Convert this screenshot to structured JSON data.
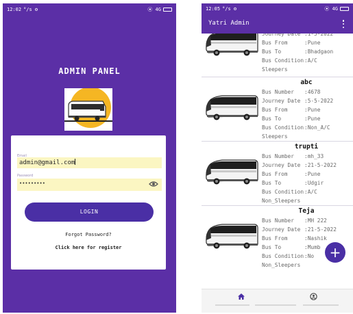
{
  "left": {
    "status": {
      "time": "12:02",
      "icons": "°/s ⚙",
      "right": "⦿ 4G"
    },
    "title": "ADMIN PANEL",
    "email_label": "Email",
    "email_value": "admin@gmail.com",
    "password_label": "Password",
    "password_value": "•••••••••",
    "login_label": "LOGIN",
    "forgot_label": "Forgot Password?",
    "register_label": "Click here for register"
  },
  "right": {
    "status": {
      "time": "12:05",
      "icons": "°/s ⚙",
      "right": "⦿ 4G"
    },
    "app_title": "Yatri Admin",
    "cards": [
      {
        "name": "",
        "fields": [
          {
            "k": "Journey Date",
            "v": ":1-5-2022"
          },
          {
            "k": "Bus From",
            "v": ":Pune"
          },
          {
            "k": "Bus To",
            "v": ":Bhadgaon"
          },
          {
            "k": "Bus Condition",
            "v": ":A/C"
          }
        ],
        "tail": "Sleepers"
      },
      {
        "name": "abc",
        "fields": [
          {
            "k": "Bus Number",
            "v": ":4678"
          },
          {
            "k": "Journey Date",
            "v": ":5-5-2022"
          },
          {
            "k": "Bus From",
            "v": ":Pune"
          },
          {
            "k": "Bus To",
            "v": ":Pune"
          },
          {
            "k": "Bus Condition",
            "v": ":Non_A/C"
          }
        ],
        "tail": "Sleepers"
      },
      {
        "name": "trupti",
        "fields": [
          {
            "k": "Bus Number",
            "v": ":mh_33"
          },
          {
            "k": "Journey Date",
            "v": ":21-5-2022"
          },
          {
            "k": "Bus From",
            "v": ":Pune"
          },
          {
            "k": "Bus To",
            "v": ":Udgir"
          },
          {
            "k": "Bus Condition",
            "v": ":A/C"
          }
        ],
        "tail": "Non_Sleepers"
      },
      {
        "name": "Teja",
        "fields": [
          {
            "k": "Bus Number",
            "v": ":MH 222"
          },
          {
            "k": "Journey Date",
            "v": ":21-5-2022"
          },
          {
            "k": "Bus From",
            "v": ":Nashik"
          },
          {
            "k": "Bus To",
            "v": ":Mumb"
          },
          {
            "k": "Bus Condition",
            "v": ":No"
          }
        ],
        "tail": "Non_Sleepers"
      }
    ],
    "fab_label": "+",
    "nav": {
      "home_icon": "home-icon",
      "profile_icon": "account-circle-icon"
    }
  },
  "colors": {
    "primary": "#5b2fa6",
    "button": "#4a2fa5",
    "field_bg": "#fbf6c2",
    "logo_sun": "#f5b623"
  }
}
